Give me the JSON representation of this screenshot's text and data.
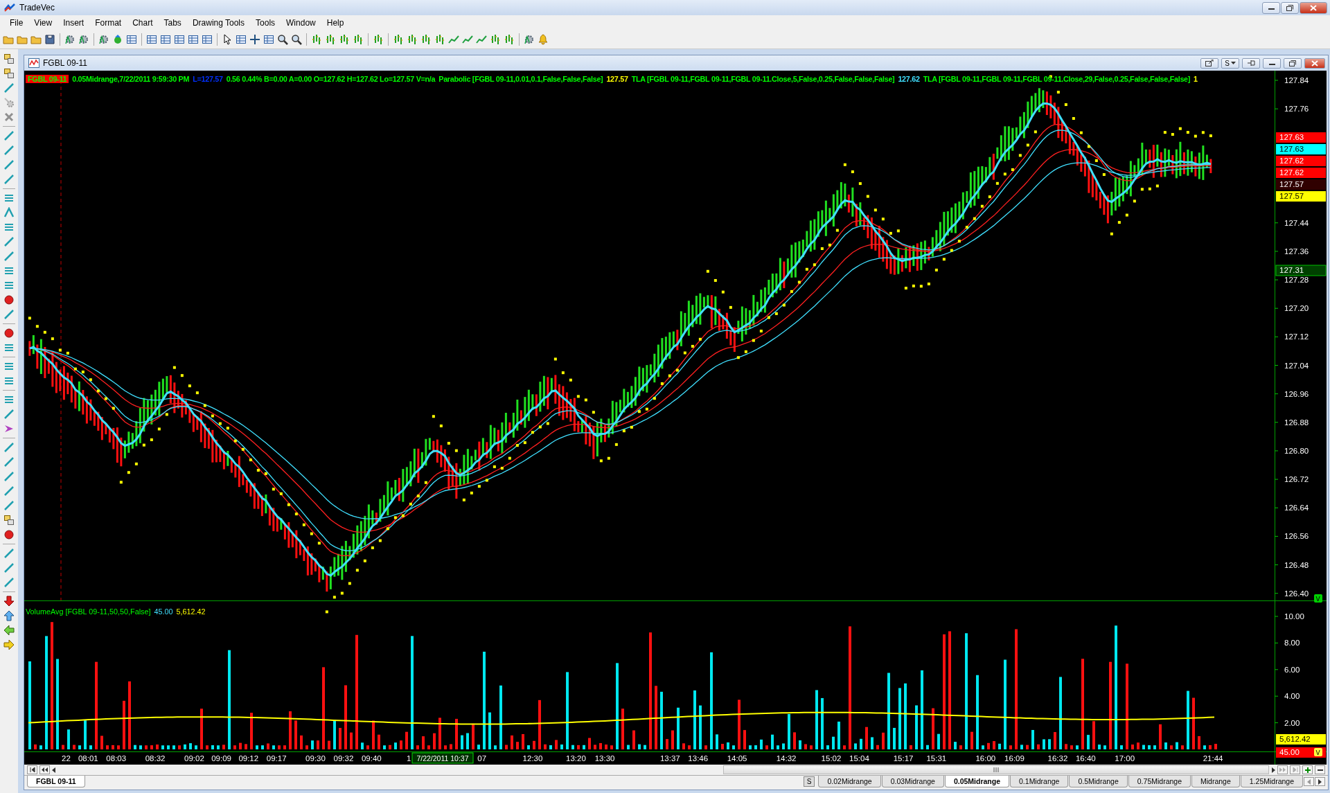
{
  "app": {
    "title": "TradeVec"
  },
  "menu": [
    "File",
    "View",
    "Insert",
    "Format",
    "Chart",
    "Tabs",
    "Drawing Tools",
    "Tools",
    "Window",
    "Help"
  ],
  "chart_window": {
    "title": "FGBL 09-11",
    "button_text": "S"
  },
  "header": [
    {
      "text": "FGBL 09-11",
      "kind": "badge",
      "color": "#ff0000"
    },
    {
      "text": "0.05Midrange,7/22/2011 9:59:30 PM",
      "kind": "text",
      "color": "#00ff00"
    },
    {
      "text": "L=127.57",
      "kind": "text",
      "color": "#0030ff"
    },
    {
      "text": "0.56 0.44% B=0.00 A=0.00 O=127.62 H=127.62 Lo=127.57 V=n/a",
      "kind": "text",
      "color": "#00ff00"
    },
    {
      "text": "Parabolic  [FGBL 09-11,0.01,0.1,False,False,False]",
      "kind": "text",
      "color": "#00ff00"
    },
    {
      "text": "127.57",
      "kind": "text",
      "color": "#ffff00"
    },
    {
      "text": "TLA  [FGBL 09-11,FGBL 09-11,FGBL 09-11.Close,5,False,0.25,False,False,False]",
      "kind": "text",
      "color": "#00ff00"
    },
    {
      "text": "127.62",
      "kind": "text",
      "color": "#40e0ff"
    },
    {
      "text": "TLA  [FGBL 09-11,FGBL 09-11,FGBL 09-11.Close,29,False,0.25,False,False,False]",
      "kind": "text",
      "color": "#00ff00"
    },
    {
      "text": "1",
      "kind": "text",
      "color": "#ffff00"
    }
  ],
  "price_axis": {
    "ticks": [
      "127.84",
      "127.76",
      "127.44",
      "127.36",
      "127.28",
      "127.20",
      "127.12",
      "127.04",
      "126.96",
      "126.88",
      "126.80",
      "126.72",
      "126.64",
      "126.56",
      "126.48",
      "126.40"
    ],
    "labels": [
      {
        "text": "127.63",
        "color": "#ff0000"
      },
      {
        "text": "127.63",
        "color": "#00ffff"
      },
      {
        "text": "127.62",
        "color": "#ff0000"
      },
      {
        "text": "127.62",
        "color": "#ff0000"
      },
      {
        "text": "127.57",
        "color": "#300000"
      },
      {
        "text": "127.57",
        "color": "#ffff00"
      },
      {
        "text": "127.31",
        "color": "#004000"
      }
    ],
    "marker": "V"
  },
  "volume_pane": {
    "legend": [
      {
        "text": "VolumeAvg  [FGBL 09-11,50,50,False]",
        "color": "#00ff00"
      },
      {
        "text": "45.00",
        "color": "#40e0ff"
      },
      {
        "text": "5,612.42",
        "color": "#ffff00"
      }
    ],
    "ticks": [
      "10.00",
      "8.00",
      "6.00",
      "4.00",
      "2.00"
    ],
    "labels": [
      {
        "text": "5,612.42",
        "color": "#ffff00"
      },
      {
        "text": "45.00",
        "color": "#ff0000"
      }
    ],
    "marker": "V"
  },
  "time_axis": {
    "labels": [
      "22",
      "08:01",
      "08:03",
      "08:32",
      "09:02",
      "09:09",
      "09:12",
      "09:17",
      "09:30",
      "09:32",
      "09:40",
      "1",
      "07",
      "12:30",
      "13:20",
      "13:30",
      "13:37",
      "13:46",
      "14:05",
      "14:32",
      "15:02",
      "15:04",
      "15:17",
      "15:31",
      "16:00",
      "16:09",
      "16:32",
      "16:40",
      "17:00",
      "21:44"
    ],
    "cursor": "7/22/2011 10:37"
  },
  "sheet_tabs": [
    {
      "label": "FGBL 09-11",
      "selected": true
    }
  ],
  "interval_button": "S",
  "interval_tabs": [
    {
      "label": "0.02Midrange",
      "selected": false
    },
    {
      "label": "0.03Midrange",
      "selected": false
    },
    {
      "label": "0.05Midrange",
      "selected": true
    },
    {
      "label": "0.1Midrange",
      "selected": false
    },
    {
      "label": "0.5Midrange",
      "selected": false
    },
    {
      "label": "0.75Midrange",
      "selected": false
    },
    {
      "label": "Midrange",
      "selected": false
    },
    {
      "label": "1.25Midrange",
      "selected": false
    }
  ]
}
